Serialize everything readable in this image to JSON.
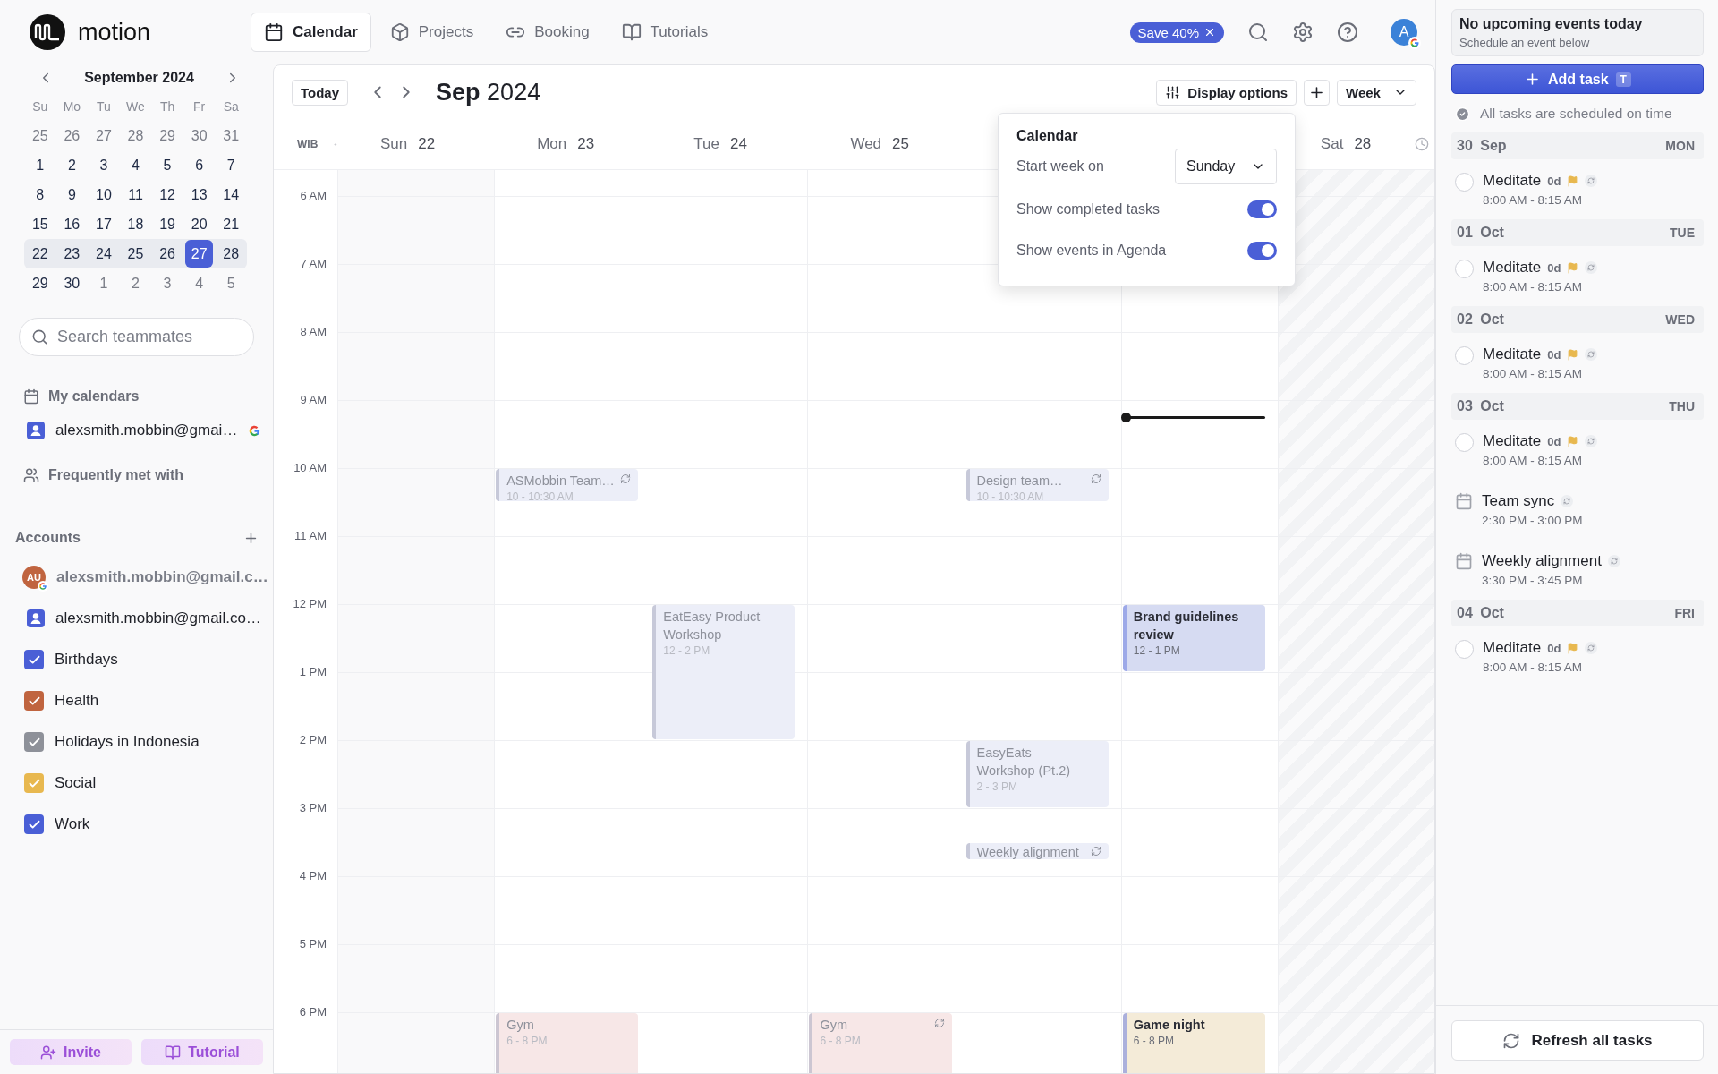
{
  "brand": {
    "name": "motion"
  },
  "nav": {
    "tabs": [
      {
        "label": "Calendar",
        "selected": true
      },
      {
        "label": "Projects",
        "selected": false
      },
      {
        "label": "Booking",
        "selected": false
      },
      {
        "label": "Tutorials",
        "selected": false
      }
    ],
    "promo": "Save 40%",
    "avatar": "A"
  },
  "mini_calendar": {
    "month": "September 2024",
    "weekdays": [
      "Su",
      "Mo",
      "Tu",
      "We",
      "Th",
      "Fr",
      "Sa"
    ],
    "weeks": [
      {
        "current": false,
        "days": [
          {
            "label": "25",
            "other_month": true,
            "selected": false
          },
          {
            "label": "26",
            "other_month": true,
            "selected": false
          },
          {
            "label": "27",
            "other_month": true,
            "selected": false
          },
          {
            "label": "28",
            "other_month": true,
            "selected": false
          },
          {
            "label": "29",
            "other_month": true,
            "selected": false
          },
          {
            "label": "30",
            "other_month": true,
            "selected": false
          },
          {
            "label": "31",
            "other_month": true,
            "selected": false
          }
        ]
      },
      {
        "current": false,
        "days": [
          {
            "label": "1",
            "other_month": false,
            "selected": false
          },
          {
            "label": "2",
            "other_month": false,
            "selected": false
          },
          {
            "label": "3",
            "other_month": false,
            "selected": false
          },
          {
            "label": "4",
            "other_month": false,
            "selected": false
          },
          {
            "label": "5",
            "other_month": false,
            "selected": false
          },
          {
            "label": "6",
            "other_month": false,
            "selected": false
          },
          {
            "label": "7",
            "other_month": false,
            "selected": false
          }
        ]
      },
      {
        "current": false,
        "days": [
          {
            "label": "8",
            "other_month": false,
            "selected": false
          },
          {
            "label": "9",
            "other_month": false,
            "selected": false
          },
          {
            "label": "10",
            "other_month": false,
            "selected": false
          },
          {
            "label": "11",
            "other_month": false,
            "selected": false
          },
          {
            "label": "12",
            "other_month": false,
            "selected": false
          },
          {
            "label": "13",
            "other_month": false,
            "selected": false
          },
          {
            "label": "14",
            "other_month": false,
            "selected": false
          }
        ]
      },
      {
        "current": false,
        "days": [
          {
            "label": "15",
            "other_month": false,
            "selected": false
          },
          {
            "label": "16",
            "other_month": false,
            "selected": false
          },
          {
            "label": "17",
            "other_month": false,
            "selected": false
          },
          {
            "label": "18",
            "other_month": false,
            "selected": false
          },
          {
            "label": "19",
            "other_month": false,
            "selected": false
          },
          {
            "label": "20",
            "other_month": false,
            "selected": false
          },
          {
            "label": "21",
            "other_month": false,
            "selected": false
          }
        ]
      },
      {
        "current": true,
        "days": [
          {
            "label": "22",
            "other_month": false,
            "selected": false
          },
          {
            "label": "23",
            "other_month": false,
            "selected": false
          },
          {
            "label": "24",
            "other_month": false,
            "selected": false
          },
          {
            "label": "25",
            "other_month": false,
            "selected": false
          },
          {
            "label": "26",
            "other_month": false,
            "selected": false
          },
          {
            "label": "27",
            "other_month": false,
            "selected": true
          },
          {
            "label": "28",
            "other_month": false,
            "selected": false
          }
        ]
      },
      {
        "current": false,
        "days": [
          {
            "label": "29",
            "other_month": false,
            "selected": false
          },
          {
            "label": "30",
            "other_month": false,
            "selected": false
          },
          {
            "label": "1",
            "other_month": true,
            "selected": false
          },
          {
            "label": "2",
            "other_month": true,
            "selected": false
          },
          {
            "label": "3",
            "other_month": true,
            "selected": false
          },
          {
            "label": "4",
            "other_month": true,
            "selected": false
          },
          {
            "label": "5",
            "other_month": true,
            "selected": false
          }
        ]
      }
    ]
  },
  "search": {
    "placeholder": "Search teammates"
  },
  "my_calendars": {
    "title": "My calendars",
    "items": [
      {
        "label": "alexsmith.mobbin@gmai…"
      }
    ]
  },
  "frequently_met": {
    "title": "Frequently met with"
  },
  "accounts": {
    "title": "Accounts",
    "items": [
      {
        "kind": "account",
        "avatar": "AU",
        "color": "#c0643f",
        "label": "alexsmith.mobbin@gmail.c…"
      },
      {
        "kind": "person",
        "color": "#4a5fd6",
        "label": "alexsmith.mobbin@gmail.co…"
      },
      {
        "kind": "calendar",
        "color": "#4a5fd6",
        "label": "Birthdays",
        "checked": true
      },
      {
        "kind": "calendar",
        "color": "#c0643f",
        "label": "Health",
        "checked": true
      },
      {
        "kind": "calendar",
        "color": "#8e9199",
        "label": "Holidays in Indonesia",
        "checked": true
      },
      {
        "kind": "calendar",
        "color": "#e8b84f",
        "label": "Social",
        "checked": true
      },
      {
        "kind": "calendar",
        "color": "#4a5fd6",
        "label": "Work",
        "checked": true
      }
    ]
  },
  "footer_buttons": [
    {
      "kind": "invite",
      "label": "Invite"
    },
    {
      "kind": "tutorial",
      "label": "Tutorial"
    }
  ],
  "calendar": {
    "today": "Today",
    "title": "**Sep** 2024",
    "display_options": "Display options",
    "view": "Week",
    "timezone": "WIB",
    "days": [
      {
        "weekday": "Sun",
        "date": "22"
      },
      {
        "weekday": "Mon",
        "date": "23",
        "events": [
          {
            "title": "ASMobbin Team…",
            "time": "10 - 10:30 AM",
            "recurring": true,
            "faded": true,
            "color": "#eceef8"
          },
          {
            "title": "Gym",
            "time": "6 - 8 PM",
            "recurring": false,
            "faded": true,
            "color": "#f7e7e7"
          }
        ]
      },
      {
        "weekday": "Tue",
        "date": "24",
        "events": [
          {
            "title": "EatEasy Product Workshop",
            "time": "12 - 2 PM",
            "recurring": false,
            "faded": true,
            "color": "#eceef8"
          }
        ]
      },
      {
        "weekday": "Wed",
        "date": "25",
        "events": [
          {
            "title": "Gym",
            "time": "6 - 8 PM",
            "recurring": true,
            "faded": true,
            "color": "#f7e7e7"
          }
        ]
      },
      {
        "events": [
          {
            "title": "Design team…",
            "time": "10 - 10:30 AM",
            "recurring": true,
            "faded": true,
            "color": "#eceef8"
          },
          {
            "title": "EasyEats Workshop (Pt.2)",
            "time": "2 - 3 PM",
            "recurring": false,
            "faded": true,
            "color": "#eceef8"
          },
          {
            "title": "Weekly alignment",
            "recurring": true,
            "faded": true,
            "color": "#eceef8"
          }
        ]
      },
      {
        "now_line": true,
        "events": [
          {
            "title": "Brand guidelines review",
            "time": "12 - 1 PM",
            "recurring": false,
            "faded": false,
            "color": "#d6dbf2"
          },
          {
            "title": "Game night",
            "time": "6 - 8 PM",
            "recurring": false,
            "faded": false,
            "color": "#f4ebd8"
          }
        ]
      },
      {
        "weekday": "Sat",
        "date": "28"
      }
    ],
    "hours": [
      "6 AM",
      "7 AM",
      "8 AM",
      "9 AM",
      "10 AM",
      "11 AM",
      "12 PM",
      "1 PM",
      "2 PM",
      "3 PM",
      "4 PM",
      "5 PM",
      "6 PM"
    ]
  },
  "display_popup": {
    "title": "Calendar",
    "start_week_label": "Start week on",
    "start_week_value": "Sunday",
    "toggles": [
      {
        "label": "Show completed tasks",
        "on": true
      },
      {
        "label": "Show events in Agenda",
        "on": true
      }
    ]
  },
  "agenda": {
    "notice_title": "No upcoming events today",
    "notice_subtitle": "Schedule an event below",
    "add_task": "Add task",
    "add_task_key": "T",
    "status": "All tasks are scheduled on time",
    "groups": [
      {
        "date": "30 Sep",
        "weekday": "MON",
        "items": [
          {
            "kind": "task",
            "title": "Meditate",
            "badge": "0d",
            "time": "8:00 AM - 8:15 AM",
            "checked": false
          }
        ]
      },
      {
        "date": "01 Oct",
        "weekday": "TUE",
        "items": [
          {
            "kind": "task",
            "title": "Meditate",
            "badge": "0d",
            "time": "8:00 AM - 8:15 AM",
            "checked": false
          }
        ]
      },
      {
        "date": "02 Oct",
        "weekday": "WED",
        "items": [
          {
            "kind": "task",
            "title": "Meditate",
            "badge": "0d",
            "time": "8:00 AM - 8:15 AM",
            "checked": false
          }
        ]
      },
      {
        "date": "03 Oct",
        "weekday": "THU",
        "items": [
          {
            "kind": "task",
            "title": "Meditate",
            "badge": "0d",
            "time": "8:00 AM - 8:15 AM",
            "checked": false
          },
          {
            "kind": "event",
            "title": "Team sync",
            "time": "2:30 PM - 3:00 PM"
          },
          {
            "kind": "event",
            "title": "Weekly alignment",
            "time": "3:30 PM - 3:45 PM"
          }
        ]
      },
      {
        "date": "04 Oct",
        "weekday": "FRI",
        "items": [
          {
            "kind": "task",
            "title": "Meditate",
            "badge": "0d",
            "time": "8:00 AM - 8:15 AM",
            "checked": false
          }
        ]
      }
    ],
    "refresh": "Refresh all tasks"
  }
}
